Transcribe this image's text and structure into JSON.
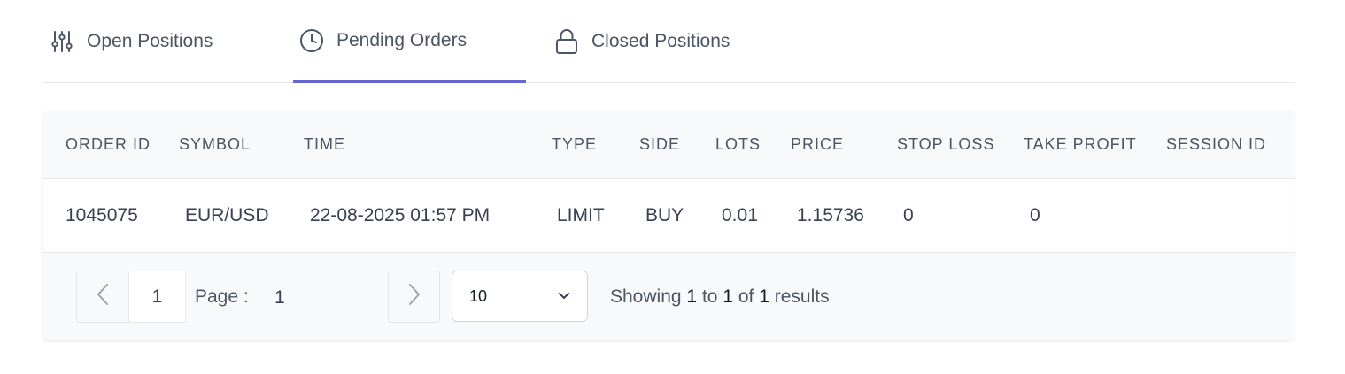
{
  "tabs": [
    {
      "label": "Open Positions",
      "icon": "sliders-icon",
      "active": false
    },
    {
      "label": "Pending Orders",
      "icon": "clock-icon",
      "active": true
    },
    {
      "label": "Closed Positions",
      "icon": "lock-icon",
      "active": false
    }
  ],
  "table": {
    "columns": [
      "ORDER ID",
      "SYMBOL",
      "TIME",
      "TYPE",
      "SIDE",
      "LOTS",
      "PRICE",
      "STOP LOSS",
      "TAKE PROFIT",
      "SESSION ID"
    ],
    "rows": [
      [
        "1045075",
        "EUR/USD",
        "22-08-2025 01:57 PM",
        "LIMIT",
        "BUY",
        "0.01",
        "1.15736",
        "0",
        "0",
        ""
      ]
    ]
  },
  "pagination": {
    "current_page": "1",
    "page_label": "Page :",
    "page_value": "1",
    "page_size": "10",
    "showing_prefix": "Showing",
    "from": "1",
    "to_word": "to",
    "to": "1",
    "of_word": "of",
    "total": "1",
    "results_word": "results"
  },
  "colors": {
    "active_tab_underline": "#6366d1",
    "card_background": "#f8f9fb",
    "border": "#e5e7eb"
  }
}
